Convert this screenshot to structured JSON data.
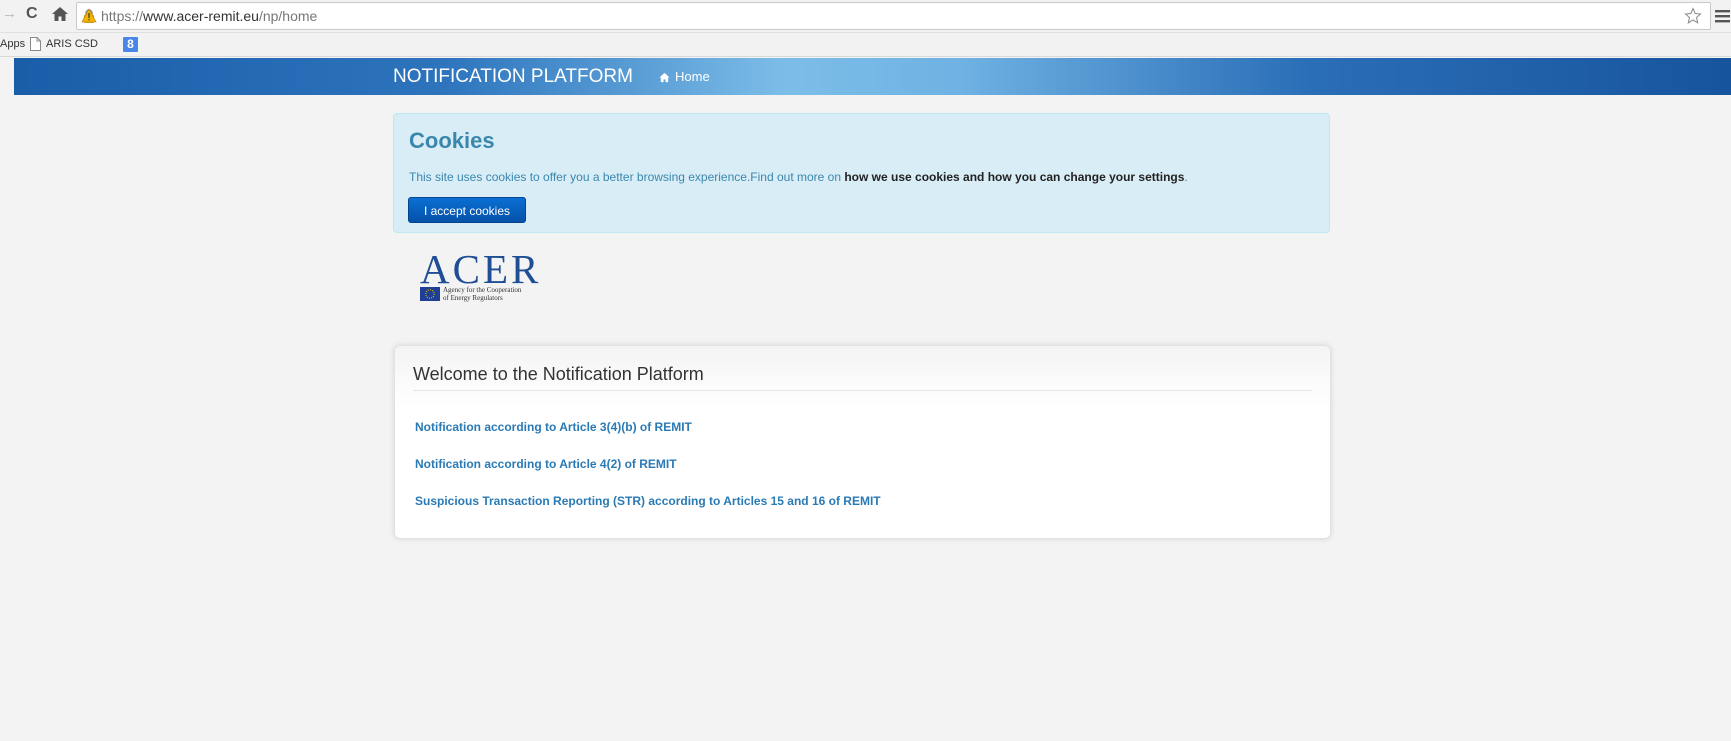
{
  "browser": {
    "url_scheme": "https://",
    "url_host": "www.acer-remit.eu",
    "url_path": "/np/home",
    "icons": {
      "forward": "forward-arrow-icon",
      "reload": "reload-icon",
      "home": "home-icon",
      "lock": "lock-warning-icon",
      "bookmark_star": "star-icon",
      "menu": "hamburger-menu-icon"
    }
  },
  "bookmarks": {
    "apps_label": "Apps",
    "items": [
      {
        "label": "ARIS CSD",
        "icon": "document-icon"
      },
      {
        "label": "8",
        "icon": "google-icon"
      }
    ]
  },
  "navbar": {
    "brand": "NOTIFICATION PLATFORM",
    "home_label": "Home",
    "home_icon": "home-icon"
  },
  "cookies": {
    "title": "Cookies",
    "text": "This site uses cookies to offer you a better browsing experience.Find out more on ",
    "link_text": "how we use cookies and how you can change your settings",
    "text_end": ".",
    "accept_label": "I accept cookies"
  },
  "logo": {
    "wordmark": "ACER",
    "subtitle_line1": "Agency for the Cooperation",
    "subtitle_line2": "of Energy Regulators"
  },
  "welcome": {
    "title": "Welcome to the Notification Platform",
    "links": [
      "Notification according to Article 3(4)(b) of REMIT",
      "Notification according to Article 4(2) of REMIT",
      "Suspicious Transaction Reporting (STR) according to Articles 15 and 16 of REMIT"
    ]
  },
  "colors": {
    "navbar_blue": "#1a5da8",
    "cookie_bg": "#d9edf7",
    "cookie_text": "#3a87ad",
    "button_blue": "#0a6fd3",
    "link_blue": "#2a7ab5",
    "acer_blue": "#1f4e94"
  }
}
